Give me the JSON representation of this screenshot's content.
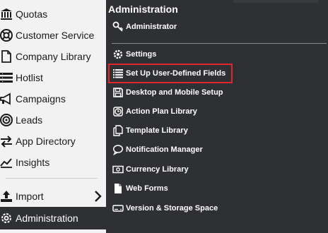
{
  "nav": {
    "items": [
      {
        "label": "Quotas",
        "icon": "bank-icon"
      },
      {
        "label": "Customer Service",
        "icon": "lifebuoy-icon"
      },
      {
        "label": "Company Library",
        "icon": "document-icon"
      },
      {
        "label": "Hotlist",
        "icon": "list-icon"
      },
      {
        "label": "Campaigns",
        "icon": "megaphone-icon"
      },
      {
        "label": "Leads",
        "icon": "target-icon"
      },
      {
        "label": "App Directory",
        "icon": "arrows-icon"
      },
      {
        "label": "Insights",
        "icon": "chart-line-icon"
      },
      {
        "label": "Import",
        "icon": "upload-icon"
      },
      {
        "label": "Administration",
        "icon": "gear-icon"
      }
    ]
  },
  "panel": {
    "title": "Administration",
    "items": [
      {
        "label": "Administrator",
        "icon": "key-icon"
      },
      {
        "label": "Settings",
        "icon": "gear-icon"
      },
      {
        "label": "Set Up User-Defined Fields",
        "icon": "list-icon"
      },
      {
        "label": "Desktop and Mobile Setup",
        "icon": "save-icon"
      },
      {
        "label": "Action Plan Library",
        "icon": "clock-icon"
      },
      {
        "label": "Template Library",
        "icon": "copy-icon"
      },
      {
        "label": "Notification Manager",
        "icon": "speech-bubble-icon"
      },
      {
        "label": "Currency Library",
        "icon": "money-icon"
      },
      {
        "label": "Web Forms",
        "icon": "file-icon"
      },
      {
        "label": "Version & Storage Space",
        "icon": "storage-icon"
      }
    ],
    "highlight_color": "#e0262b"
  }
}
